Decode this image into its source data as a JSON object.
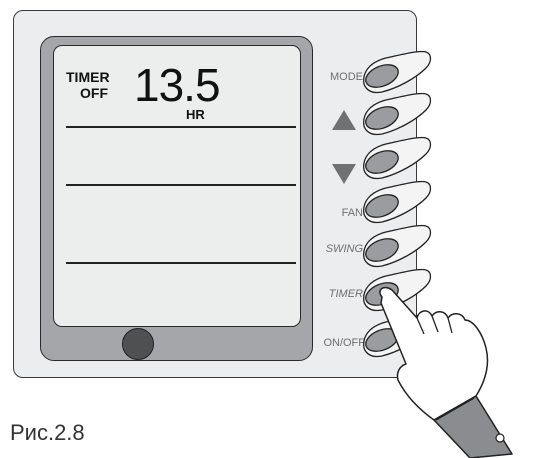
{
  "display": {
    "mode_label_line1": "TIMER",
    "mode_label_line2": "OFF",
    "value": "13.5",
    "unit": "HR"
  },
  "buttons": [
    {
      "id": "mode",
      "label": "MODE",
      "italic": false
    },
    {
      "id": "up",
      "label": "",
      "icon": "triangle-up-icon"
    },
    {
      "id": "down",
      "label": "",
      "icon": "triangle-down-icon"
    },
    {
      "id": "fan",
      "label": "FAN",
      "italic": false
    },
    {
      "id": "swing",
      "label": "SWING",
      "italic": true
    },
    {
      "id": "timer",
      "label": "TIMER",
      "italic": true
    },
    {
      "id": "onoff",
      "label": "ON/OFF",
      "italic": false
    }
  ],
  "caption": "Рис.2.8",
  "colors": {
    "panel": "#ecedef",
    "bezel": "#a4a6a9",
    "button": "#9a9ca0",
    "indicator": "#4f5052",
    "hand_cuff": "#8a8c8f"
  }
}
